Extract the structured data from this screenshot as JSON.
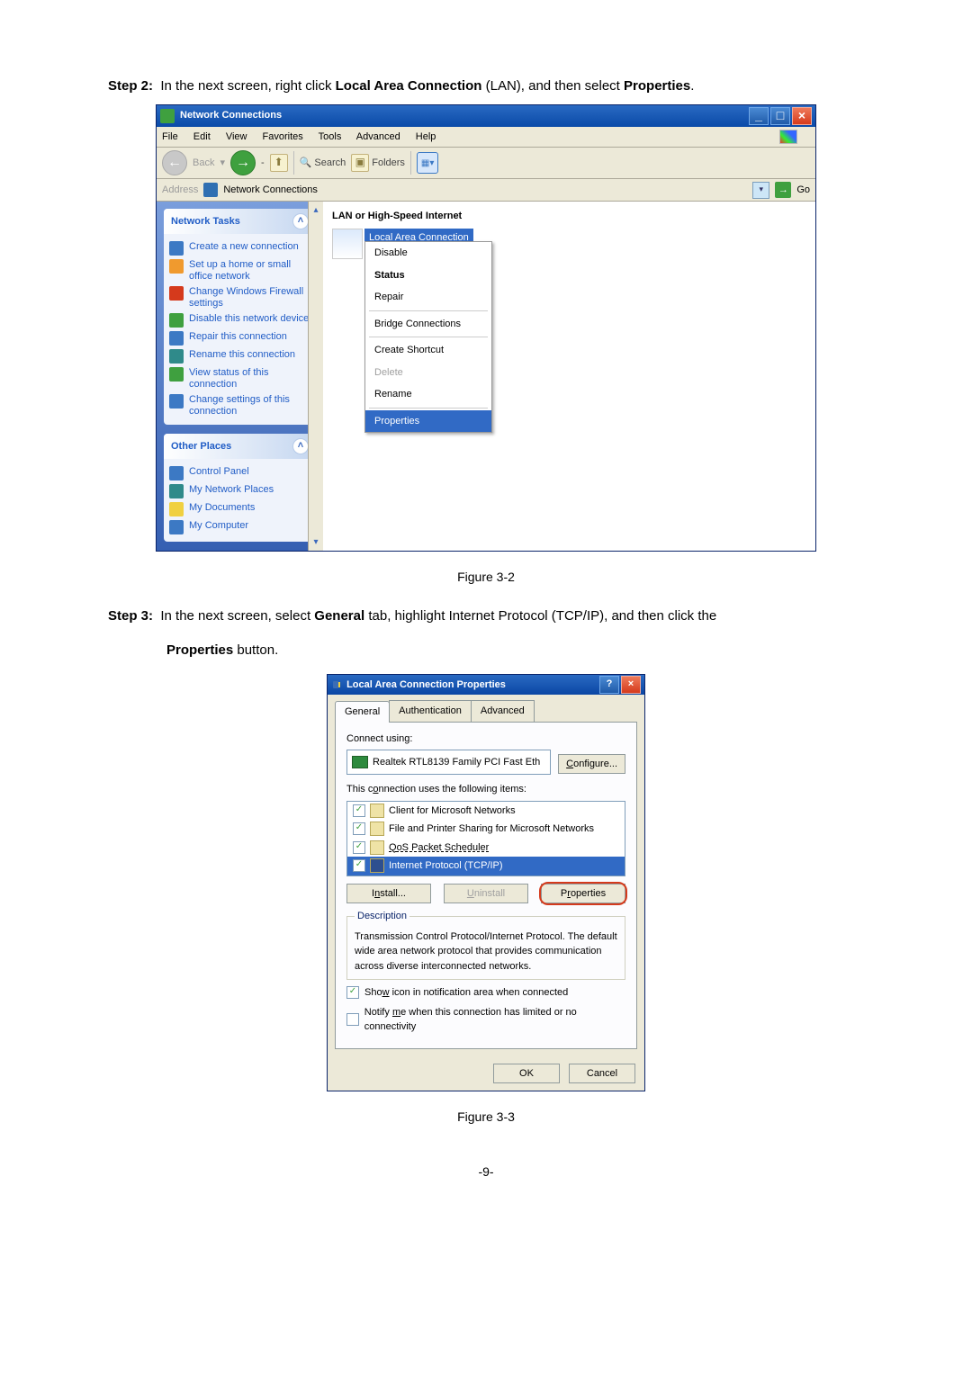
{
  "step2": {
    "label": "Step 2:",
    "text1": "In the next screen, right click ",
    "bold1": "Local Area Connection",
    "text2": " (LAN), and then select ",
    "bold2": "Properties",
    "text3": "."
  },
  "fig1": "Figure 3-2",
  "step3": {
    "label": "Step 3:",
    "text1": "In the next screen, select ",
    "bold1": "General",
    "text2": " tab, highlight Internet Protocol (TCP/IP), and then click the ",
    "bold2": "Properties",
    "text3": " button."
  },
  "fig2": "Figure 3-3",
  "pagenum": "-9-",
  "nc": {
    "title": "Network Connections",
    "menu": {
      "file": "File",
      "edit": "Edit",
      "view": "View",
      "fav": "Favorites",
      "tools": "Tools",
      "adv": "Advanced",
      "help": "Help"
    },
    "toolbar": {
      "back": "Back",
      "search": "Search",
      "folders": "Folders"
    },
    "addr": {
      "label": "Address",
      "value": "Network Connections",
      "go": "Go"
    },
    "heading": "LAN or High-Speed Internet",
    "lac": "Local Area Connection",
    "context": {
      "disable": "Disable",
      "status": "Status",
      "repair": "Repair",
      "bridge": "Bridge Connections",
      "shortcut": "Create Shortcut",
      "delete": "Delete",
      "rename": "Rename",
      "props": "Properties"
    },
    "panel1": {
      "title": "Network Tasks",
      "i0": "Create a new connection",
      "i1": "Set up a home or small office network",
      "i2": "Change Windows Firewall settings",
      "i3": "Disable this network device",
      "i4": "Repair this connection",
      "i5": "Rename this connection",
      "i6": "View status of this connection",
      "i7": "Change settings of this connection"
    },
    "panel2": {
      "title": "Other Places",
      "i0": "Control Panel",
      "i1": "My Network Places",
      "i2": "My Documents",
      "i3": "My Computer"
    }
  },
  "lacp": {
    "title": "Local Area Connection Properties",
    "tabs": {
      "general": "General",
      "auth": "Authentication",
      "adv": "Advanced"
    },
    "connect": "Connect using:",
    "adapter": "Realtek RTL8139 Family PCI Fast Eth",
    "configure": "Configure...",
    "uses": "This connection uses the following items:",
    "items": {
      "i0": "Client for Microsoft Networks",
      "i1": "File and Printer Sharing for Microsoft Networks",
      "i2": "QoS Packet Scheduler",
      "i3": "Internet Protocol (TCP/IP)"
    },
    "install": "Install...",
    "uninstall": "Uninstall",
    "properties": "Properties",
    "desc_label": "Description",
    "desc": "Transmission Control Protocol/Internet Protocol. The default wide area network protocol that provides communication across diverse interconnected networks.",
    "show": "Show icon in notification area when connected",
    "notify": "Notify me when this connection has limited or no connectivity",
    "ok": "OK",
    "cancel": "Cancel"
  }
}
